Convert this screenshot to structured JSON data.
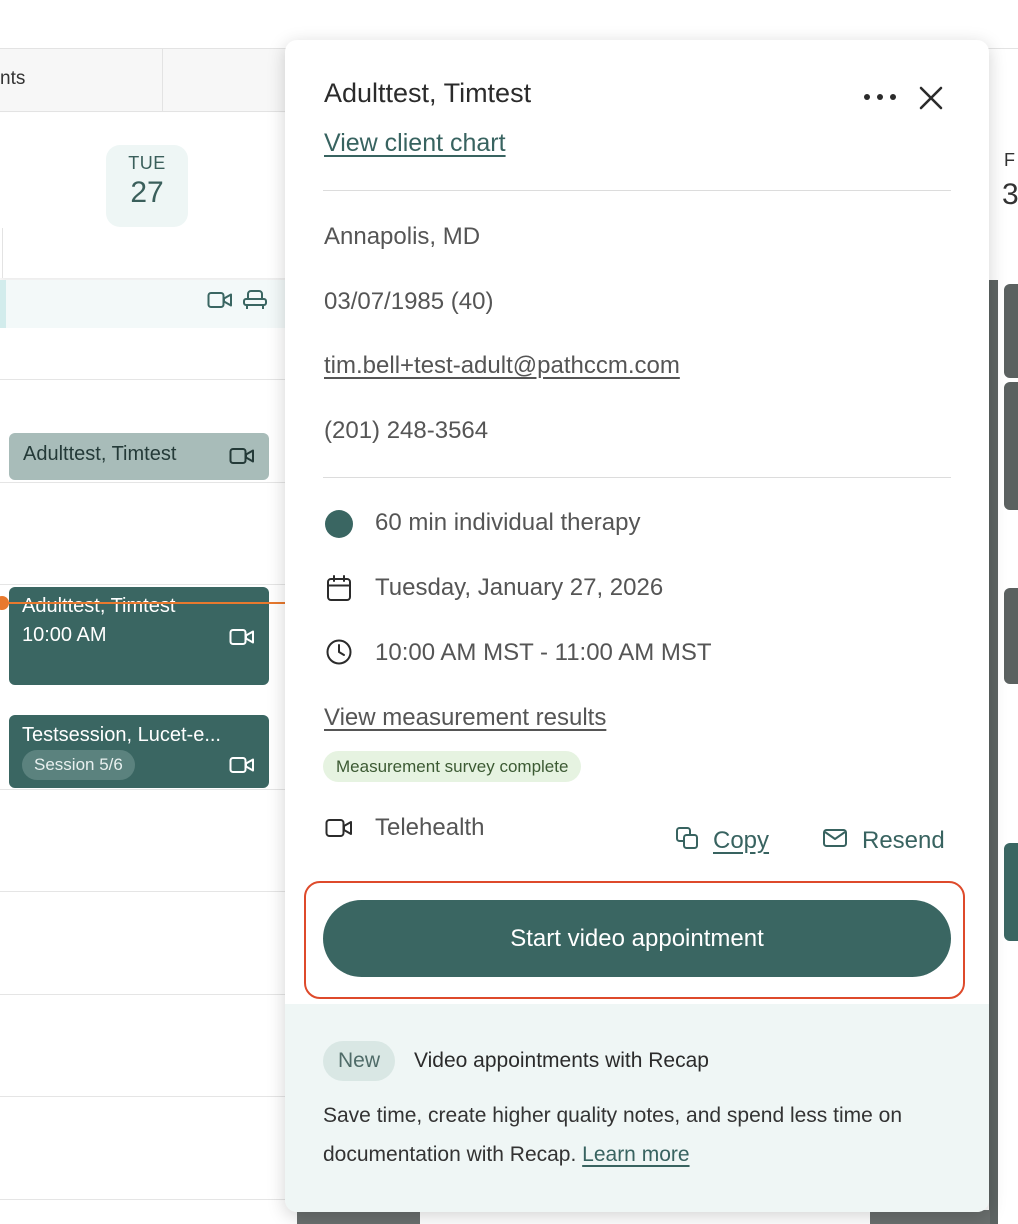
{
  "calendar": {
    "tab_fragment": "nts",
    "day": {
      "dow": "TUE",
      "num": "27"
    },
    "right_day": {
      "dow": "F",
      "num": "3"
    },
    "events": [
      {
        "title": "Adulttest, Timtest"
      },
      {
        "title": "Adulttest, Timtest",
        "time": "10:00 AM"
      },
      {
        "title": "Testsession, Lucet-e...",
        "badge": "Session 5/6"
      }
    ]
  },
  "popover": {
    "client_name": "Adulttest, Timtest",
    "view_chart_link": "View client chart",
    "location": "Annapolis, MD",
    "dob": "03/07/1985 (40)",
    "email": "tim.bell+test-adult@pathccm.com",
    "phone": "(201) 248-3564",
    "service": "60 min individual therapy",
    "date": "Tuesday, January 27, 2026",
    "time_range": "10:00 AM MST - 11:00 AM MST",
    "measurement_link": "View measurement results",
    "measurement_badge": "Measurement survey complete",
    "modality": "Telehealth",
    "copy_label": "Copy",
    "resend_label": "Resend",
    "start_button": "Start video appointment",
    "service_color": "#3a6662",
    "recap": {
      "badge": "New",
      "title": "Video appointments with Recap",
      "body": "Save time, create higher quality notes, and spend less time on documentation with Recap.",
      "learn_more": "Learn more"
    }
  },
  "colors": {
    "brand": "#3a6662",
    "highlight": "#de4a2b",
    "now_line": "#e8792e"
  }
}
